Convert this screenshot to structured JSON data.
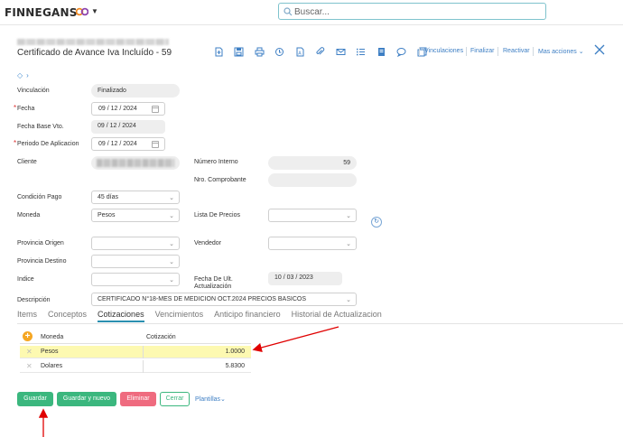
{
  "brand": {
    "name": "FINNEGANS"
  },
  "search": {
    "placeholder": "Buscar..."
  },
  "header": {
    "title": "Certificado de Avance Iva Incluído - 59"
  },
  "toolbar": {
    "icons": [
      "new-doc-icon",
      "save-icon",
      "print-icon",
      "history-icon",
      "pdf-icon",
      "attach-icon",
      "email-icon",
      "list-icon",
      "notes-icon",
      "comment-icon",
      "copy-icon"
    ],
    "links": {
      "vinculaciones": "Vinculaciones",
      "finalizar": "Finalizar",
      "reactivar": "Reactivar",
      "mas_acciones": "Mas acciones"
    }
  },
  "form": {
    "vinculacion": {
      "label": "Vinculación",
      "value": "Finalizado"
    },
    "fecha": {
      "label": "Fecha",
      "value": "09 / 12 / 2024"
    },
    "fecha_base_vto": {
      "label": "Fecha Base Vto.",
      "value": "09 / 12 / 2024"
    },
    "periodo": {
      "label": "Periodo De Aplicacion",
      "value": "09 / 12 / 2024"
    },
    "cliente": {
      "label": "Cliente"
    },
    "numero_interno": {
      "label": "Número Interno",
      "value": "59"
    },
    "nro_comprobante": {
      "label": "Nro. Comprobante",
      "value": ""
    },
    "condicion_pago": {
      "label": "Condición Pago",
      "value": "45 días"
    },
    "moneda": {
      "label": "Moneda",
      "value": "Pesos"
    },
    "lista_precios": {
      "label": "Lista De Precios",
      "value": ""
    },
    "provincia_origen": {
      "label": "Provincia Origen",
      "value": ""
    },
    "vendedor": {
      "label": "Vendedor",
      "value": ""
    },
    "provincia_destino": {
      "label": "Provincia Destino",
      "value": ""
    },
    "indice": {
      "label": "Indice",
      "value": ""
    },
    "fecha_ult_act": {
      "label1": "Fecha De Ult.",
      "label2": "Actualización",
      "value": "10 / 03 / 2023"
    },
    "descripcion": {
      "label": "Descripción",
      "value": "CERTIFICADO N°18-MES DE MEDICION OCT.2024 PRECIOS BASICOS"
    }
  },
  "tabs": [
    "Items",
    "Conceptos",
    "Cotizaciones",
    "Vencimientos",
    "Anticipo financiero",
    "Historial de Actualizacion"
  ],
  "grid": {
    "headers": {
      "moneda": "Moneda",
      "cotizacion": "Cotización"
    },
    "rows": [
      {
        "moneda": "Pesos",
        "cotizacion": "1.0000",
        "highlighted": true
      },
      {
        "moneda": "Dolares",
        "cotizacion": "5.8300",
        "highlighted": false
      }
    ]
  },
  "actions": {
    "guardar": "Guardar",
    "guardar_nuevo": "Guardar y nuevo",
    "eliminar": "Eliminar",
    "cerrar": "Cerrar",
    "plantillas": "Plantillas"
  },
  "colors": {
    "accent": "#3e7fc4",
    "primary_green": "#3bb77e",
    "danger": "#ef6b7f",
    "highlight_row": "#fdf9b1",
    "annotation_arrow": "#e00000"
  }
}
